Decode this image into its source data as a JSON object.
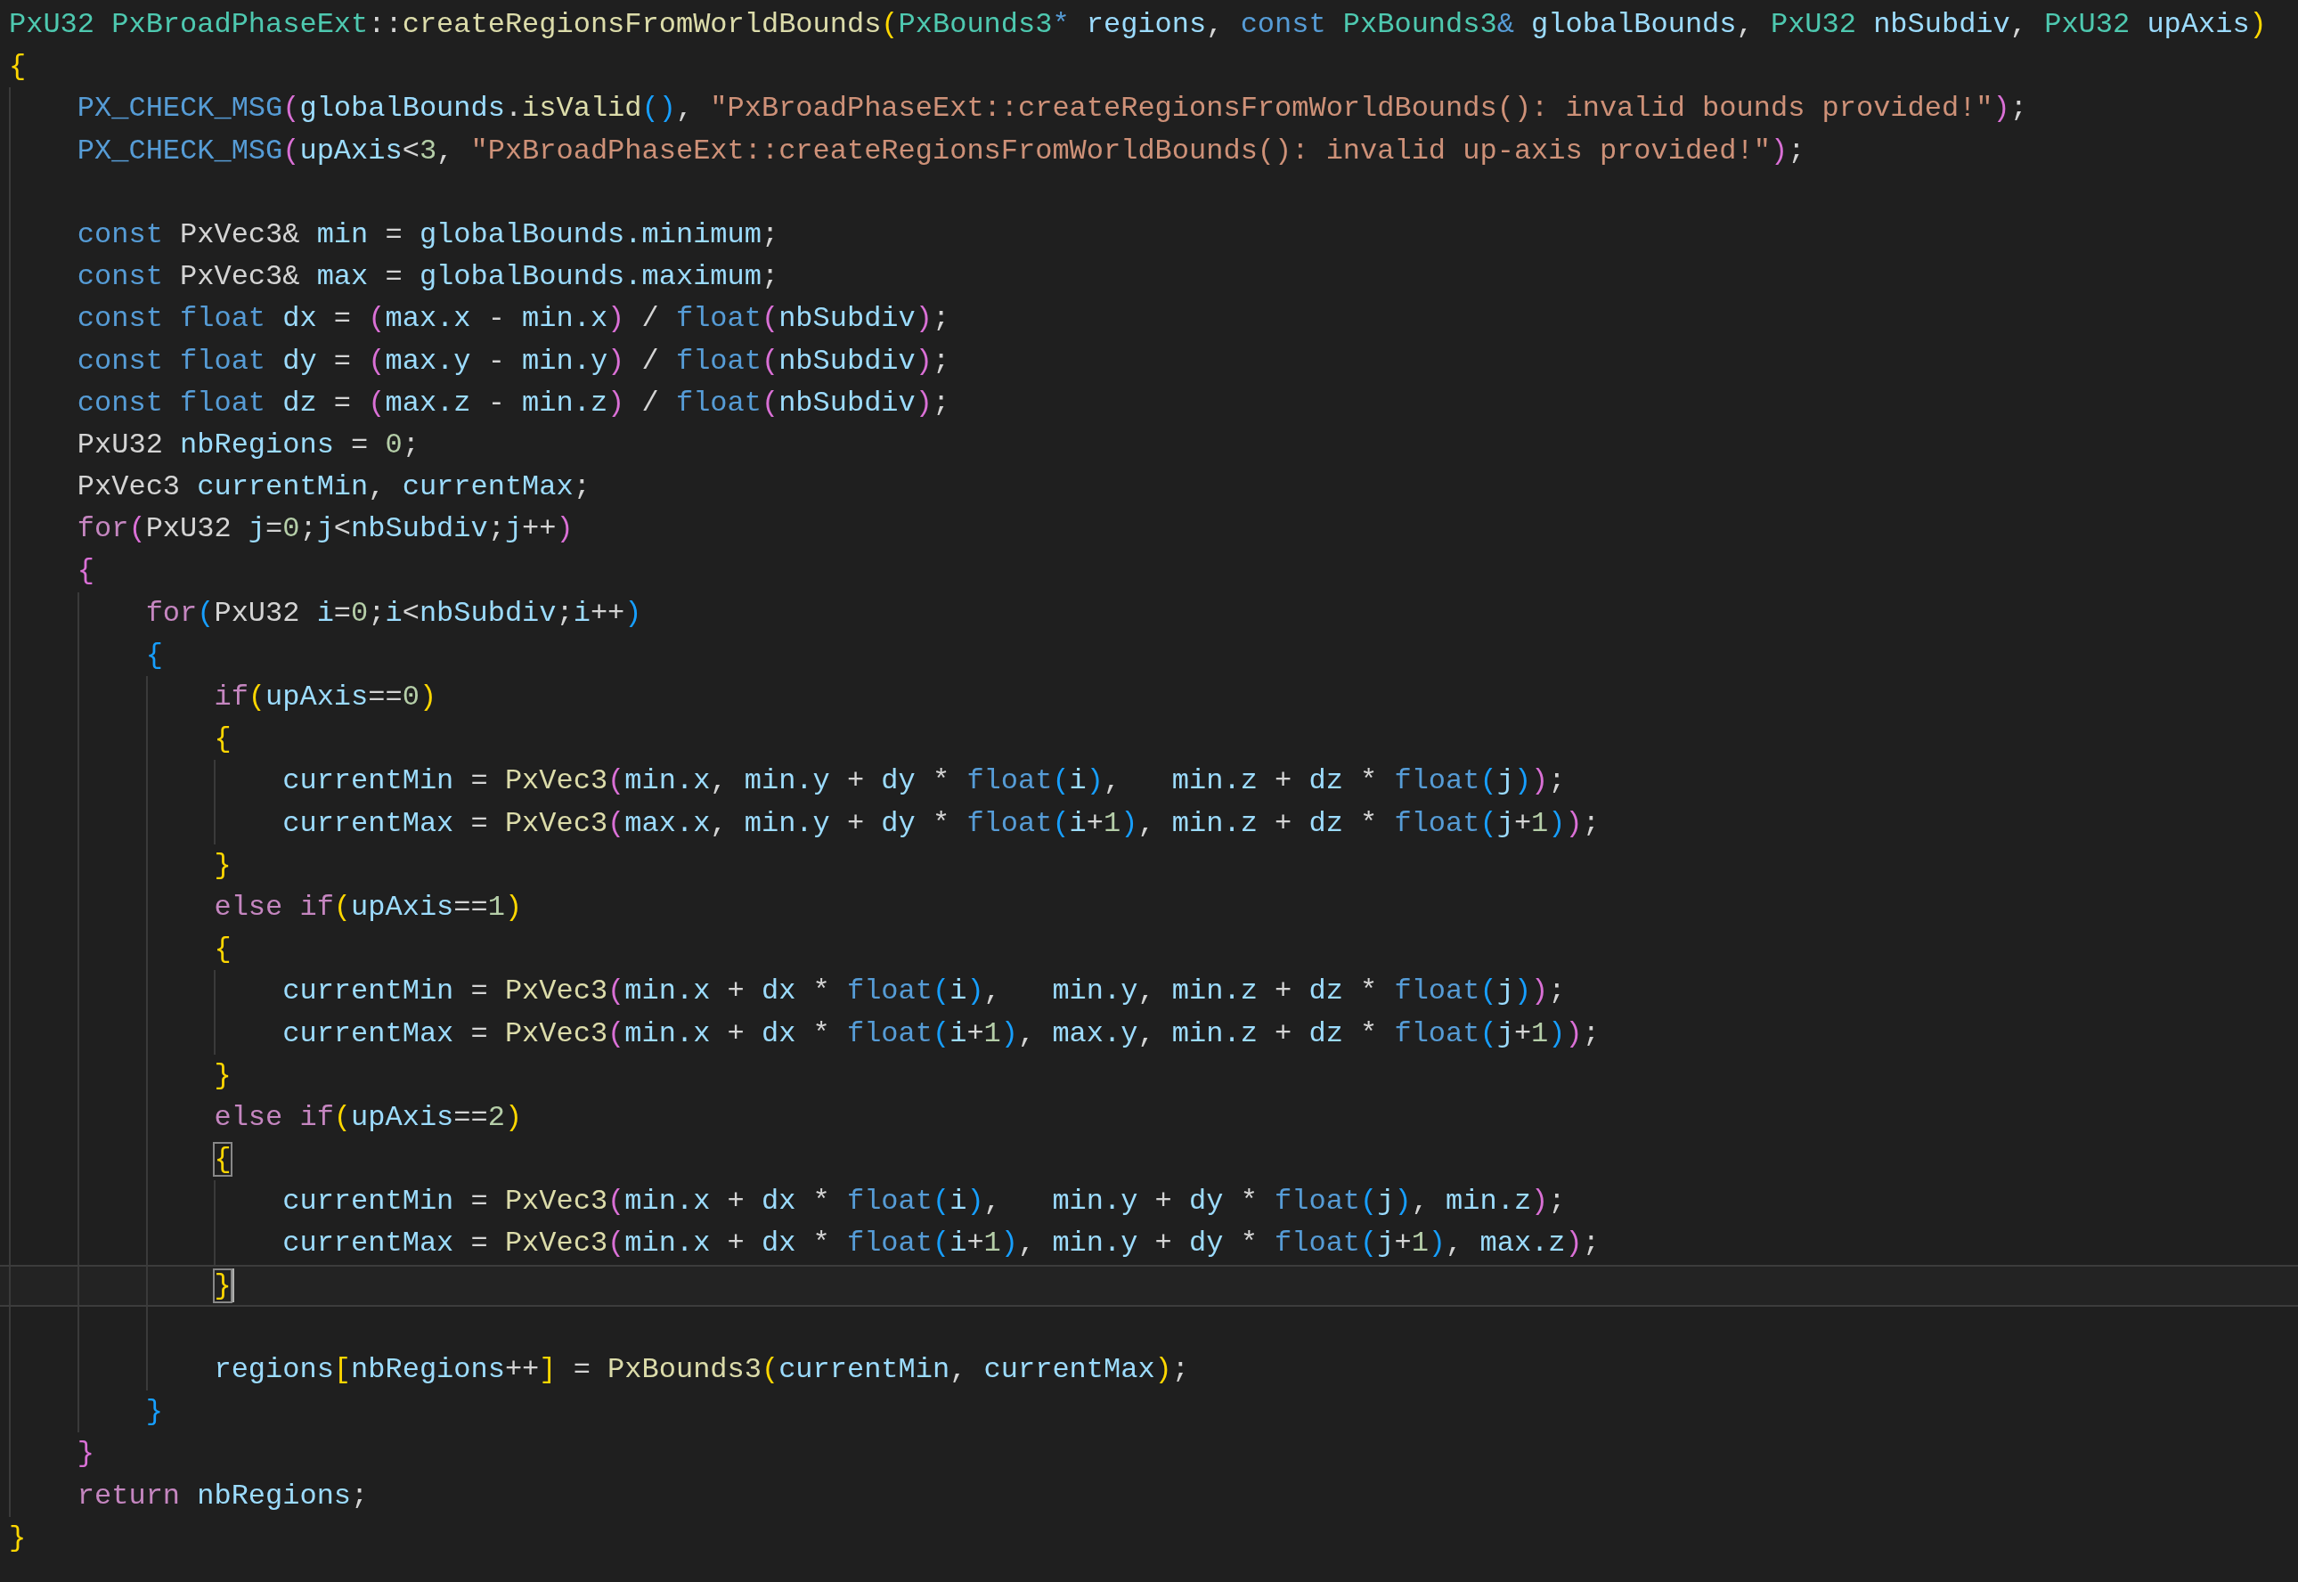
{
  "editor": {
    "lines": [
      {
        "current": false,
        "tokens": [
          {
            "kind": "type",
            "text": "PxU32"
          },
          {
            "kind": "type",
            "text": " PxBroadPhaseExt"
          },
          {
            "kind": "plain",
            "text": "::"
          },
          {
            "kind": "function",
            "text": "createRegionsFromWorldBounds"
          },
          {
            "kind": "bracket1",
            "text": "("
          },
          {
            "kind": "type",
            "text": "PxBounds3"
          },
          {
            "kind": "keyword",
            "text": "*"
          },
          {
            "kind": "variable",
            "text": " regions"
          },
          {
            "kind": "plain",
            "text": ", "
          },
          {
            "kind": "keyword",
            "text": "const"
          },
          {
            "kind": "type",
            "text": " PxBounds3"
          },
          {
            "kind": "keyword",
            "text": "&"
          },
          {
            "kind": "variable",
            "text": " globalBounds"
          },
          {
            "kind": "plain",
            "text": ", "
          },
          {
            "kind": "type",
            "text": "PxU32"
          },
          {
            "kind": "variable",
            "text": " nbSubdiv"
          },
          {
            "kind": "plain",
            "text": ", "
          },
          {
            "kind": "type",
            "text": "PxU32"
          },
          {
            "kind": "variable",
            "text": " upAxis"
          },
          {
            "kind": "bracket1",
            "text": ")"
          }
        ]
      },
      {
        "current": false,
        "tokens": [
          {
            "kind": "bracket1",
            "text": "{"
          }
        ]
      },
      {
        "current": false,
        "tokens": [
          {
            "kind": "keyword",
            "text": "    PX_CHECK_MSG"
          },
          {
            "kind": "bracket2",
            "text": "("
          },
          {
            "kind": "variable",
            "text": "globalBounds"
          },
          {
            "kind": "plain",
            "text": "."
          },
          {
            "kind": "function",
            "text": "isValid"
          },
          {
            "kind": "bracket3",
            "text": "()"
          },
          {
            "kind": "plain",
            "text": ", "
          },
          {
            "kind": "string",
            "text": "\"PxBroadPhaseExt::createRegionsFromWorldBounds(): invalid bounds provided!\""
          },
          {
            "kind": "bracket2",
            "text": ")"
          },
          {
            "kind": "plain",
            "text": ";"
          }
        ]
      },
      {
        "current": false,
        "tokens": [
          {
            "kind": "keyword",
            "text": "    PX_CHECK_MSG"
          },
          {
            "kind": "bracket2",
            "text": "("
          },
          {
            "kind": "variable",
            "text": "upAxis"
          },
          {
            "kind": "plain",
            "text": "<"
          },
          {
            "kind": "number",
            "text": "3"
          },
          {
            "kind": "plain",
            "text": ", "
          },
          {
            "kind": "string",
            "text": "\"PxBroadPhaseExt::createRegionsFromWorldBounds(): invalid up-axis provided!\""
          },
          {
            "kind": "bracket2",
            "text": ")"
          },
          {
            "kind": "plain",
            "text": ";"
          }
        ]
      },
      {
        "current": false
      },
      {
        "current": false,
        "tokens": [
          {
            "kind": "keyword",
            "text": "    const"
          },
          {
            "kind": "plain",
            "text": " PxVec3& "
          },
          {
            "kind": "variable",
            "text": "min"
          },
          {
            "kind": "plain",
            "text": " = "
          },
          {
            "kind": "variable",
            "text": "globalBounds.minimum"
          },
          {
            "kind": "plain",
            "text": ";"
          }
        ]
      },
      {
        "current": false,
        "tokens": [
          {
            "kind": "keyword",
            "text": "    const"
          },
          {
            "kind": "plain",
            "text": " PxVec3& "
          },
          {
            "kind": "variable",
            "text": "max"
          },
          {
            "kind": "plain",
            "text": " = "
          },
          {
            "kind": "variable",
            "text": "globalBounds.maximum"
          },
          {
            "kind": "plain",
            "text": ";"
          }
        ]
      },
      {
        "current": false,
        "tokens": [
          {
            "kind": "keyword",
            "text": "    const"
          },
          {
            "kind": "keyword",
            "text": " float"
          },
          {
            "kind": "variable",
            "text": " dx"
          },
          {
            "kind": "plain",
            "text": " = "
          },
          {
            "kind": "bracket2",
            "text": "("
          },
          {
            "kind": "variable",
            "text": "max.x"
          },
          {
            "kind": "plain",
            "text": " - "
          },
          {
            "kind": "variable",
            "text": "min.x"
          },
          {
            "kind": "bracket2",
            "text": ")"
          },
          {
            "kind": "plain",
            "text": " / "
          },
          {
            "kind": "keyword",
            "text": "float"
          },
          {
            "kind": "bracket2",
            "text": "("
          },
          {
            "kind": "variable",
            "text": "nbSubdiv"
          },
          {
            "kind": "bracket2",
            "text": ")"
          },
          {
            "kind": "plain",
            "text": ";"
          }
        ]
      },
      {
        "current": false,
        "tokens": [
          {
            "kind": "keyword",
            "text": "    const"
          },
          {
            "kind": "keyword",
            "text": " float"
          },
          {
            "kind": "variable",
            "text": " dy"
          },
          {
            "kind": "plain",
            "text": " = "
          },
          {
            "kind": "bracket2",
            "text": "("
          },
          {
            "kind": "variable",
            "text": "max.y"
          },
          {
            "kind": "plain",
            "text": " - "
          },
          {
            "kind": "variable",
            "text": "min.y"
          },
          {
            "kind": "bracket2",
            "text": ")"
          },
          {
            "kind": "plain",
            "text": " / "
          },
          {
            "kind": "keyword",
            "text": "float"
          },
          {
            "kind": "bracket2",
            "text": "("
          },
          {
            "kind": "variable",
            "text": "nbSubdiv"
          },
          {
            "kind": "bracket2",
            "text": ")"
          },
          {
            "kind": "plain",
            "text": ";"
          }
        ]
      },
      {
        "current": false,
        "tokens": [
          {
            "kind": "keyword",
            "text": "    const"
          },
          {
            "kind": "keyword",
            "text": " float"
          },
          {
            "kind": "variable",
            "text": " dz"
          },
          {
            "kind": "plain",
            "text": " = "
          },
          {
            "kind": "bracket2",
            "text": "("
          },
          {
            "kind": "variable",
            "text": "max.z"
          },
          {
            "kind": "plain",
            "text": " - "
          },
          {
            "kind": "variable",
            "text": "min.z"
          },
          {
            "kind": "bracket2",
            "text": ")"
          },
          {
            "kind": "plain",
            "text": " / "
          },
          {
            "kind": "keyword",
            "text": "float"
          },
          {
            "kind": "bracket2",
            "text": "("
          },
          {
            "kind": "variable",
            "text": "nbSubdiv"
          },
          {
            "kind": "bracket2",
            "text": ")"
          },
          {
            "kind": "plain",
            "text": ";"
          }
        ]
      },
      {
        "current": false,
        "tokens": [
          {
            "kind": "plain",
            "text": "    PxU32 "
          },
          {
            "kind": "variable",
            "text": "nbRegions"
          },
          {
            "kind": "plain",
            "text": " = "
          },
          {
            "kind": "number",
            "text": "0"
          },
          {
            "kind": "plain",
            "text": ";"
          }
        ]
      },
      {
        "current": false,
        "tokens": [
          {
            "kind": "plain",
            "text": "    PxVec3 "
          },
          {
            "kind": "variable",
            "text": "currentMin"
          },
          {
            "kind": "plain",
            "text": ", "
          },
          {
            "kind": "variable",
            "text": "currentMax"
          },
          {
            "kind": "plain",
            "text": ";"
          }
        ]
      },
      {
        "current": false,
        "tokens": [
          {
            "kind": "control",
            "text": "    for"
          },
          {
            "kind": "bracket2",
            "text": "("
          },
          {
            "kind": "plain",
            "text": "PxU32 "
          },
          {
            "kind": "variable",
            "text": "j"
          },
          {
            "kind": "plain",
            "text": "="
          },
          {
            "kind": "number",
            "text": "0"
          },
          {
            "kind": "plain",
            "text": ";"
          },
          {
            "kind": "variable",
            "text": "j"
          },
          {
            "kind": "plain",
            "text": "<"
          },
          {
            "kind": "variable",
            "text": "nbSubdiv"
          },
          {
            "kind": "plain",
            "text": ";"
          },
          {
            "kind": "variable",
            "text": "j"
          },
          {
            "kind": "plain",
            "text": "++"
          },
          {
            "kind": "bracket2",
            "text": ")"
          }
        ]
      },
      {
        "current": false,
        "tokens": [
          {
            "kind": "bracket2",
            "text": "    {"
          }
        ]
      },
      {
        "current": false,
        "tokens": [
          {
            "kind": "control",
            "text": "        for"
          },
          {
            "kind": "bracket3",
            "text": "("
          },
          {
            "kind": "plain",
            "text": "PxU32 "
          },
          {
            "kind": "variable",
            "text": "i"
          },
          {
            "kind": "plain",
            "text": "="
          },
          {
            "kind": "number",
            "text": "0"
          },
          {
            "kind": "plain",
            "text": ";"
          },
          {
            "kind": "variable",
            "text": "i"
          },
          {
            "kind": "plain",
            "text": "<"
          },
          {
            "kind": "variable",
            "text": "nbSubdiv"
          },
          {
            "kind": "plain",
            "text": ";"
          },
          {
            "kind": "variable",
            "text": "i"
          },
          {
            "kind": "plain",
            "text": "++"
          },
          {
            "kind": "bracket3",
            "text": ")"
          }
        ]
      },
      {
        "current": false,
        "tokens": [
          {
            "kind": "bracket3",
            "text": "        {"
          }
        ]
      },
      {
        "current": false,
        "tokens": [
          {
            "kind": "control",
            "text": "            if"
          },
          {
            "kind": "bracket1",
            "text": "("
          },
          {
            "kind": "variable",
            "text": "upAxis"
          },
          {
            "kind": "plain",
            "text": "=="
          },
          {
            "kind": "number",
            "text": "0"
          },
          {
            "kind": "bracket1",
            "text": ")"
          }
        ]
      },
      {
        "current": false,
        "tokens": [
          {
            "kind": "bracket1",
            "text": "            {"
          }
        ]
      },
      {
        "current": false,
        "tokens": [
          {
            "kind": "variable",
            "text": "                currentMin"
          },
          {
            "kind": "plain",
            "text": " = "
          },
          {
            "kind": "function",
            "text": "PxVec3"
          },
          {
            "kind": "bracket2",
            "text": "("
          },
          {
            "kind": "variable",
            "text": "min.x"
          },
          {
            "kind": "plain",
            "text": ", "
          },
          {
            "kind": "variable",
            "text": "min.y"
          },
          {
            "kind": "plain",
            "text": " + "
          },
          {
            "kind": "variable",
            "text": "dy"
          },
          {
            "kind": "plain",
            "text": " * "
          },
          {
            "kind": "keyword",
            "text": "float"
          },
          {
            "kind": "bracket3",
            "text": "("
          },
          {
            "kind": "variable",
            "text": "i"
          },
          {
            "kind": "bracket3",
            "text": ")"
          },
          {
            "kind": "plain",
            "text": ",   "
          },
          {
            "kind": "variable",
            "text": "min.z"
          },
          {
            "kind": "plain",
            "text": " + "
          },
          {
            "kind": "variable",
            "text": "dz"
          },
          {
            "kind": "plain",
            "text": " * "
          },
          {
            "kind": "keyword",
            "text": "float"
          },
          {
            "kind": "bracket3",
            "text": "("
          },
          {
            "kind": "variable",
            "text": "j"
          },
          {
            "kind": "bracket3",
            "text": ")"
          },
          {
            "kind": "bracket2",
            "text": ")"
          },
          {
            "kind": "plain",
            "text": ";"
          }
        ]
      },
      {
        "current": false,
        "tokens": [
          {
            "kind": "variable",
            "text": "                currentMax"
          },
          {
            "kind": "plain",
            "text": " = "
          },
          {
            "kind": "function",
            "text": "PxVec3"
          },
          {
            "kind": "bracket2",
            "text": "("
          },
          {
            "kind": "variable",
            "text": "max.x"
          },
          {
            "kind": "plain",
            "text": ", "
          },
          {
            "kind": "variable",
            "text": "min.y"
          },
          {
            "kind": "plain",
            "text": " + "
          },
          {
            "kind": "variable",
            "text": "dy"
          },
          {
            "kind": "plain",
            "text": " * "
          },
          {
            "kind": "keyword",
            "text": "float"
          },
          {
            "kind": "bracket3",
            "text": "("
          },
          {
            "kind": "variable",
            "text": "i"
          },
          {
            "kind": "plain",
            "text": "+"
          },
          {
            "kind": "number",
            "text": "1"
          },
          {
            "kind": "bracket3",
            "text": ")"
          },
          {
            "kind": "plain",
            "text": ", "
          },
          {
            "kind": "variable",
            "text": "min.z"
          },
          {
            "kind": "plain",
            "text": " + "
          },
          {
            "kind": "variable",
            "text": "dz"
          },
          {
            "kind": "plain",
            "text": " * "
          },
          {
            "kind": "keyword",
            "text": "float"
          },
          {
            "kind": "bracket3",
            "text": "("
          },
          {
            "kind": "variable",
            "text": "j"
          },
          {
            "kind": "plain",
            "text": "+"
          },
          {
            "kind": "number",
            "text": "1"
          },
          {
            "kind": "bracket3",
            "text": ")"
          },
          {
            "kind": "bracket2",
            "text": ")"
          },
          {
            "kind": "plain",
            "text": ";"
          }
        ]
      },
      {
        "current": false,
        "tokens": [
          {
            "kind": "bracket1",
            "text": "            }"
          }
        ]
      },
      {
        "current": false,
        "tokens": [
          {
            "kind": "control",
            "text": "            else if"
          },
          {
            "kind": "bracket1",
            "text": "("
          },
          {
            "kind": "variable",
            "text": "upAxis"
          },
          {
            "kind": "plain",
            "text": "=="
          },
          {
            "kind": "number",
            "text": "1"
          },
          {
            "kind": "bracket1",
            "text": ")"
          }
        ]
      },
      {
        "current": false,
        "tokens": [
          {
            "kind": "bracket1",
            "text": "            {"
          }
        ]
      },
      {
        "current": false,
        "tokens": [
          {
            "kind": "variable",
            "text": "                currentMin"
          },
          {
            "kind": "plain",
            "text": " = "
          },
          {
            "kind": "function",
            "text": "PxVec3"
          },
          {
            "kind": "bracket2",
            "text": "("
          },
          {
            "kind": "variable",
            "text": "min.x"
          },
          {
            "kind": "plain",
            "text": " + "
          },
          {
            "kind": "variable",
            "text": "dx"
          },
          {
            "kind": "plain",
            "text": " * "
          },
          {
            "kind": "keyword",
            "text": "float"
          },
          {
            "kind": "bracket3",
            "text": "("
          },
          {
            "kind": "variable",
            "text": "i"
          },
          {
            "kind": "bracket3",
            "text": ")"
          },
          {
            "kind": "plain",
            "text": ",   "
          },
          {
            "kind": "variable",
            "text": "min.y"
          },
          {
            "kind": "plain",
            "text": ", "
          },
          {
            "kind": "variable",
            "text": "min.z"
          },
          {
            "kind": "plain",
            "text": " + "
          },
          {
            "kind": "variable",
            "text": "dz"
          },
          {
            "kind": "plain",
            "text": " * "
          },
          {
            "kind": "keyword",
            "text": "float"
          },
          {
            "kind": "bracket3",
            "text": "("
          },
          {
            "kind": "variable",
            "text": "j"
          },
          {
            "kind": "bracket3",
            "text": ")"
          },
          {
            "kind": "bracket2",
            "text": ")"
          },
          {
            "kind": "plain",
            "text": ";"
          }
        ]
      },
      {
        "current": false,
        "tokens": [
          {
            "kind": "variable",
            "text": "                currentMax"
          },
          {
            "kind": "plain",
            "text": " = "
          },
          {
            "kind": "function",
            "text": "PxVec3"
          },
          {
            "kind": "bracket2",
            "text": "("
          },
          {
            "kind": "variable",
            "text": "min.x"
          },
          {
            "kind": "plain",
            "text": " + "
          },
          {
            "kind": "variable",
            "text": "dx"
          },
          {
            "kind": "plain",
            "text": " * "
          },
          {
            "kind": "keyword",
            "text": "float"
          },
          {
            "kind": "bracket3",
            "text": "("
          },
          {
            "kind": "variable",
            "text": "i"
          },
          {
            "kind": "plain",
            "text": "+"
          },
          {
            "kind": "number",
            "text": "1"
          },
          {
            "kind": "bracket3",
            "text": ")"
          },
          {
            "kind": "plain",
            "text": ", "
          },
          {
            "kind": "variable",
            "text": "max.y"
          },
          {
            "kind": "plain",
            "text": ", "
          },
          {
            "kind": "variable",
            "text": "min.z"
          },
          {
            "kind": "plain",
            "text": " + "
          },
          {
            "kind": "variable",
            "text": "dz"
          },
          {
            "kind": "plain",
            "text": " * "
          },
          {
            "kind": "keyword",
            "text": "float"
          },
          {
            "kind": "bracket3",
            "text": "("
          },
          {
            "kind": "variable",
            "text": "j"
          },
          {
            "kind": "plain",
            "text": "+"
          },
          {
            "kind": "number",
            "text": "1"
          },
          {
            "kind": "bracket3",
            "text": ")"
          },
          {
            "kind": "bracket2",
            "text": ")"
          },
          {
            "kind": "plain",
            "text": ";"
          }
        ]
      },
      {
        "current": false,
        "tokens": [
          {
            "kind": "bracket1",
            "text": "            }"
          }
        ]
      },
      {
        "current": false,
        "tokens": [
          {
            "kind": "control",
            "text": "            else if"
          },
          {
            "kind": "bracket1",
            "text": "("
          },
          {
            "kind": "variable",
            "text": "upAxis"
          },
          {
            "kind": "plain",
            "text": "=="
          },
          {
            "kind": "number",
            "text": "2"
          },
          {
            "kind": "bracket1",
            "text": ")"
          }
        ]
      },
      {
        "current": false,
        "tokens": [
          {
            "kind": "bracket1-matched",
            "text": "            {"
          }
        ]
      },
      {
        "current": false,
        "tokens": [
          {
            "kind": "variable",
            "text": "                currentMin"
          },
          {
            "kind": "plain",
            "text": " = "
          },
          {
            "kind": "function",
            "text": "PxVec3"
          },
          {
            "kind": "bracket2",
            "text": "("
          },
          {
            "kind": "variable",
            "text": "min.x"
          },
          {
            "kind": "plain",
            "text": " + "
          },
          {
            "kind": "variable",
            "text": "dx"
          },
          {
            "kind": "plain",
            "text": " * "
          },
          {
            "kind": "keyword",
            "text": "float"
          },
          {
            "kind": "bracket3",
            "text": "("
          },
          {
            "kind": "variable",
            "text": "i"
          },
          {
            "kind": "bracket3",
            "text": ")"
          },
          {
            "kind": "plain",
            "text": ",   "
          },
          {
            "kind": "variable",
            "text": "min.y"
          },
          {
            "kind": "plain",
            "text": " + "
          },
          {
            "kind": "variable",
            "text": "dy"
          },
          {
            "kind": "plain",
            "text": " * "
          },
          {
            "kind": "keyword",
            "text": "float"
          },
          {
            "kind": "bracket3",
            "text": "("
          },
          {
            "kind": "variable",
            "text": "j"
          },
          {
            "kind": "bracket3",
            "text": ")"
          },
          {
            "kind": "plain",
            "text": ", "
          },
          {
            "kind": "variable",
            "text": "min.z"
          },
          {
            "kind": "bracket2",
            "text": ")"
          },
          {
            "kind": "plain",
            "text": ";"
          }
        ]
      },
      {
        "current": false,
        "tokens": [
          {
            "kind": "variable",
            "text": "                currentMax"
          },
          {
            "kind": "plain",
            "text": " = "
          },
          {
            "kind": "function",
            "text": "PxVec3"
          },
          {
            "kind": "bracket2",
            "text": "("
          },
          {
            "kind": "variable",
            "text": "min.x"
          },
          {
            "kind": "plain",
            "text": " + "
          },
          {
            "kind": "variable",
            "text": "dx"
          },
          {
            "kind": "plain",
            "text": " * "
          },
          {
            "kind": "keyword",
            "text": "float"
          },
          {
            "kind": "bracket3",
            "text": "("
          },
          {
            "kind": "variable",
            "text": "i"
          },
          {
            "kind": "plain",
            "text": "+"
          },
          {
            "kind": "number",
            "text": "1"
          },
          {
            "kind": "bracket3",
            "text": ")"
          },
          {
            "kind": "plain",
            "text": ", "
          },
          {
            "kind": "variable",
            "text": "min.y"
          },
          {
            "kind": "plain",
            "text": " + "
          },
          {
            "kind": "variable",
            "text": "dy"
          },
          {
            "kind": "plain",
            "text": " * "
          },
          {
            "kind": "keyword",
            "text": "float"
          },
          {
            "kind": "bracket3",
            "text": "("
          },
          {
            "kind": "variable",
            "text": "j"
          },
          {
            "kind": "plain",
            "text": "+"
          },
          {
            "kind": "number",
            "text": "1"
          },
          {
            "kind": "bracket3",
            "text": ")"
          },
          {
            "kind": "plain",
            "text": ", "
          },
          {
            "kind": "variable",
            "text": "max.z"
          },
          {
            "kind": "bracket2",
            "text": ")"
          },
          {
            "kind": "plain",
            "text": ";"
          }
        ]
      },
      {
        "current": true,
        "tokens": [
          {
            "kind": "bracket1-matched",
            "text": "            }"
          }
        ]
      },
      {
        "current": false
      },
      {
        "current": false,
        "tokens": [
          {
            "kind": "variable",
            "text": "            regions"
          },
          {
            "kind": "bracket1",
            "text": "["
          },
          {
            "kind": "variable",
            "text": "nbRegions"
          },
          {
            "kind": "plain",
            "text": "++"
          },
          {
            "kind": "bracket1",
            "text": "]"
          },
          {
            "kind": "plain",
            "text": " = "
          },
          {
            "kind": "function",
            "text": "PxBounds3"
          },
          {
            "kind": "bracket1",
            "text": "("
          },
          {
            "kind": "variable",
            "text": "currentMin"
          },
          {
            "kind": "plain",
            "text": ", "
          },
          {
            "kind": "variable",
            "text": "currentMax"
          },
          {
            "kind": "bracket1",
            "text": ")"
          },
          {
            "kind": "plain",
            "text": ";"
          }
        ]
      },
      {
        "current": false,
        "tokens": [
          {
            "kind": "bracket3",
            "text": "        }"
          }
        ]
      },
      {
        "current": false,
        "tokens": [
          {
            "kind": "bracket2",
            "text": "    }"
          }
        ]
      },
      {
        "current": false,
        "tokens": [
          {
            "kind": "control",
            "text": "    return"
          },
          {
            "kind": "variable",
            "text": " nbRegions"
          },
          {
            "kind": "plain",
            "text": ";"
          }
        ]
      },
      {
        "current": false,
        "tokens": [
          {
            "kind": "bracket1",
            "text": "}"
          }
        ]
      }
    ]
  }
}
